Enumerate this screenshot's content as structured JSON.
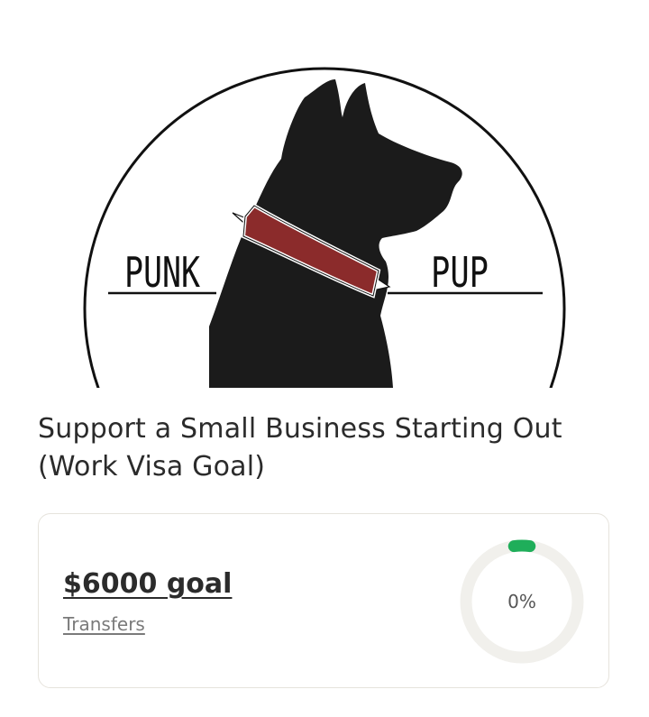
{
  "hero": {
    "logo_left_word": "PUNK",
    "logo_right_word": "PUP",
    "logo_colors": {
      "outline": "#111111",
      "dog": "#1b1b1b",
      "collar": "#8b2b2b"
    }
  },
  "campaign": {
    "title": "Support a Small Business Starting Out (Work Visa Goal)"
  },
  "goal": {
    "amount_label": "$6000 goal",
    "sub_label": "Transfers",
    "progress_label": "0%",
    "progress_fraction": 0,
    "colors": {
      "ring_track": "#f1f0ec",
      "ring_progress": "#1fae5a"
    }
  }
}
